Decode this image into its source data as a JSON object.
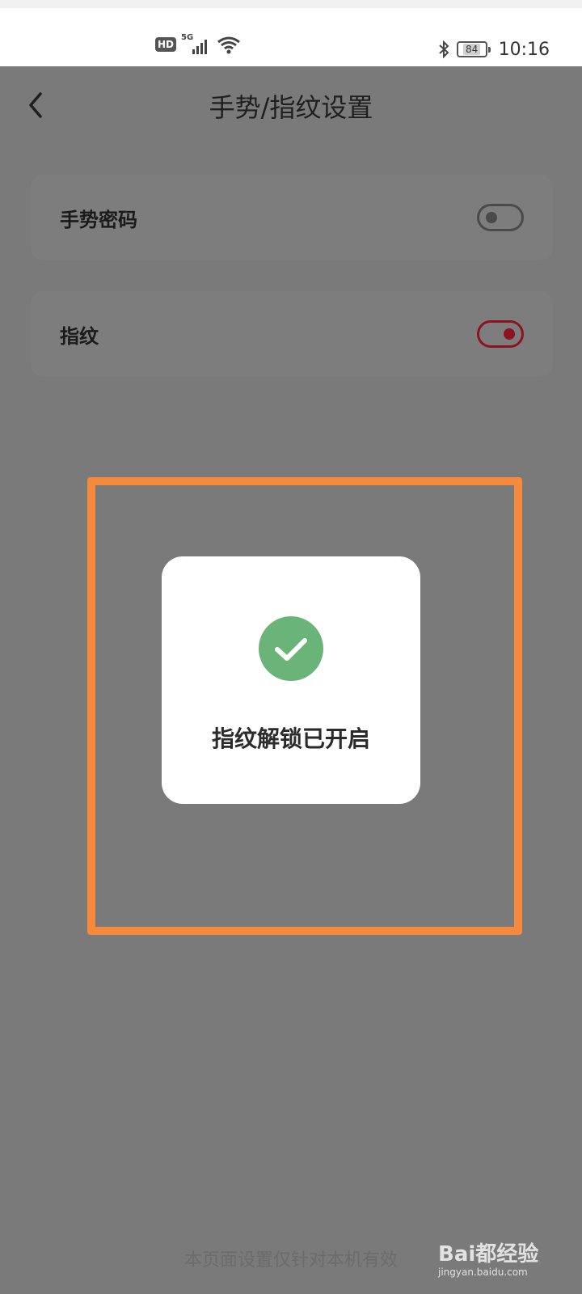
{
  "status_bar": {
    "hd": "HD",
    "network": "5G",
    "battery": "84",
    "time": "10:16"
  },
  "header": {
    "title": "手势/指纹设置"
  },
  "settings": [
    {
      "label": "手势密码",
      "enabled": false
    },
    {
      "label": "指纹",
      "enabled": true
    }
  ],
  "toast": {
    "message": "指纹解锁已开启"
  },
  "footer": {
    "note": "本页面设置仅针对本机有效"
  },
  "watermark": {
    "brand": "Bai都经验",
    "url": "jingyan.baidu.com"
  },
  "colors": {
    "overlay": "#7a7a7a",
    "toggle_on": "#8b1420",
    "success": "#6ab47a",
    "highlight": "#f58a3c"
  }
}
